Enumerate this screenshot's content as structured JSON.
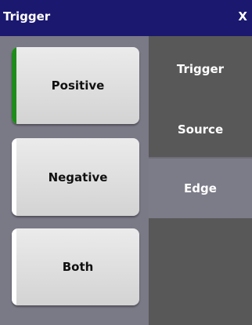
{
  "window": {
    "title": "Trigger",
    "close_label": "X"
  },
  "options": [
    {
      "label": "Positive",
      "selected": true
    },
    {
      "label": "Negative",
      "selected": false
    },
    {
      "label": "Both",
      "selected": false
    }
  ],
  "tabs": [
    {
      "label": "Trigger"
    },
    {
      "label": "Source"
    },
    {
      "label": "Edge",
      "active": true
    }
  ],
  "colors": {
    "titlebar": "#1a186f",
    "selected_indicator": "#1e8c1a",
    "active_tab": "#7c7b88",
    "inactive_tab": "#585858"
  }
}
